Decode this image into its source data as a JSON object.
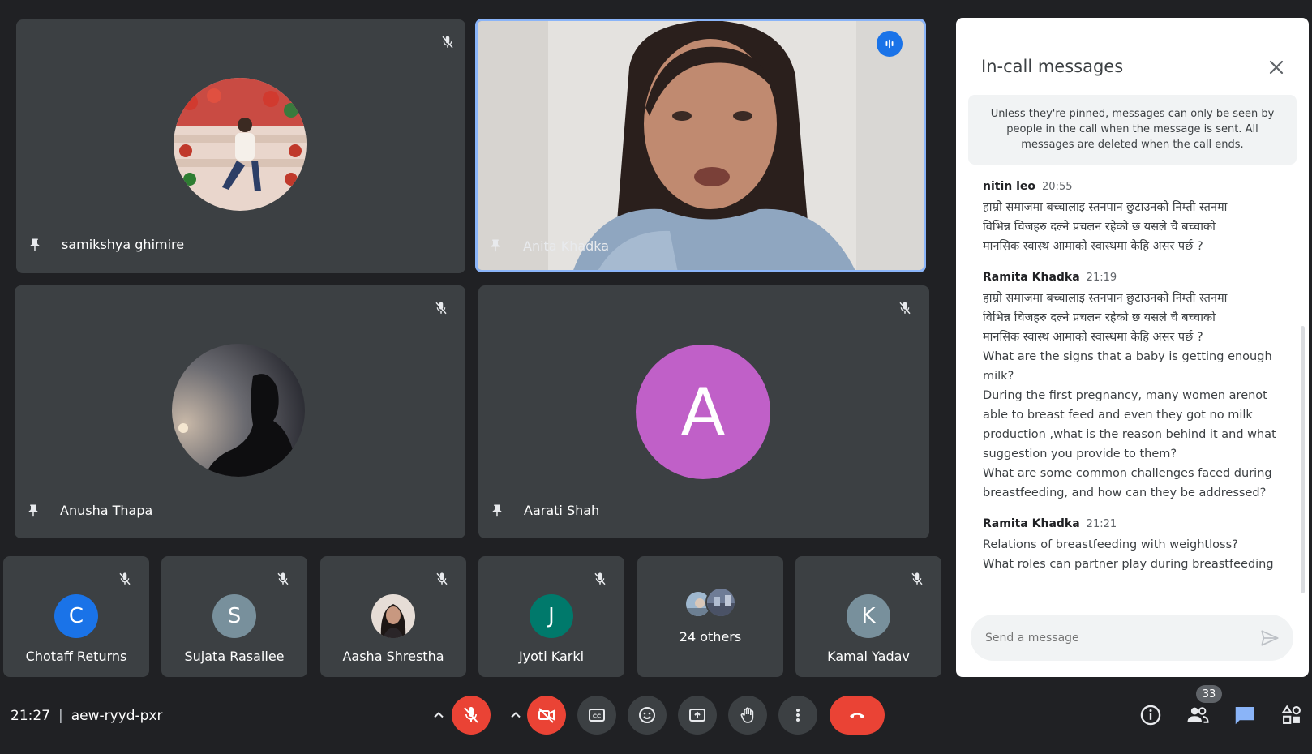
{
  "tiles": {
    "samikshya": {
      "name": "samikshya ghimire"
    },
    "anita": {
      "name": "Anita Khadka"
    },
    "anusha": {
      "name": "Anusha Thapa"
    },
    "aarati": {
      "name": "Aarati Shah",
      "initial": "A",
      "color": "#c060c8"
    }
  },
  "small_tiles": [
    {
      "name": "Chotaff Returns",
      "initial": "C",
      "color": "#1a73e8"
    },
    {
      "name": "Sujata Rasailee",
      "initial": "S",
      "color": "#78909c"
    },
    {
      "name": "Aasha Shrestha",
      "initial": ""
    },
    {
      "name": "Jyoti Karki",
      "initial": "J",
      "color": "#00796b"
    },
    {
      "name": "24 others"
    },
    {
      "name": "Kamal Yadav",
      "initial": "K",
      "color": "#78909c"
    }
  ],
  "chat": {
    "title": "In-call messages",
    "notice": "Unless they're pinned, messages can only be seen by people in the call when the message is sent. All messages are deleted when the call ends.",
    "messages": [
      {
        "sender": "nitin leo",
        "time": "20:55",
        "lines": [
          "हाम्रो समाजमा बच्चालाइ स्तनपान छुटाउनको निम्ती स्तनमा",
          "विभिन्न चिजहरु दल्ने प्रचलन रहेको छ यसले चै बच्चाको",
          "मानसिक स्वास्थ आमाको स्वास्थमा केहि असर पर्छ ?"
        ]
      },
      {
        "sender": "Ramita Khadka",
        "time": "21:19",
        "lines": [
          "हाम्रो समाजमा बच्चालाइ स्तनपान छुटाउनको निम्ती स्तनमा",
          "विभिन्न चिजहरु दल्ने प्रचलन रहेको छ यसले चै बच्चाको",
          "मानसिक स्वास्थ आमाको स्वास्थमा केहि असर पर्छ ?",
          "What are the signs that a baby is getting enough",
          "milk?",
          "During the first pregnancy, many women arenot",
          "able to breast feed and even they got no milk",
          "production ,what is the reason behind it and what",
          "suggestion you provide to them?",
          "What are some common challenges faced during",
          "breastfeeding, and how can they be addressed?"
        ]
      },
      {
        "sender": "Ramita Khadka",
        "time": "21:21",
        "lines": [
          "Relations of breastfeeding with weightloss?",
          "What roles can partner play during breastfeeding"
        ]
      }
    ],
    "input_placeholder": "Send a message"
  },
  "bottom": {
    "time": "21:27",
    "separator": "|",
    "meeting_code": "aew-ryyd-pxr",
    "participants_count": "33"
  },
  "colors": {
    "end_call": "#ea4335",
    "active_border": "#8ab4f8",
    "chat_active": "#8ab4f8"
  }
}
